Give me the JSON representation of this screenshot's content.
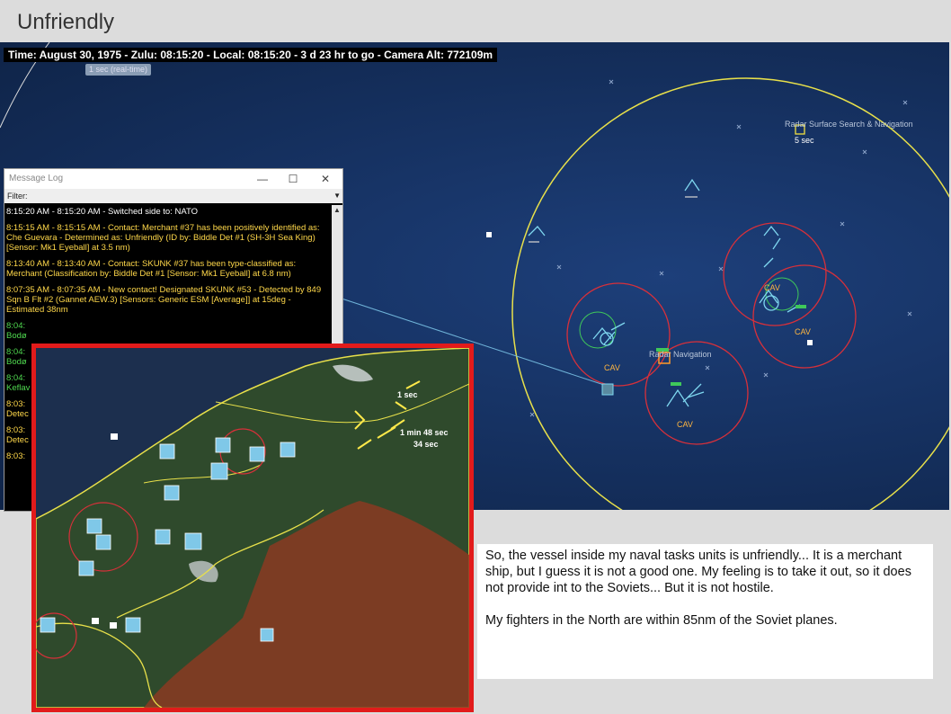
{
  "slide": {
    "title": "Unfriendly"
  },
  "game": {
    "time_bar": "Time: August 30, 1975 - Zulu: 08:15:20 - Local: 08:15:20 - 3 d 23 hr to go -  Camera Alt: 772109m",
    "speed_label": "1 sec (real-time)",
    "map_labels": {
      "radar_surface": "Radar Surface Search & Navigation",
      "radar_navigation": "Radar Navigation",
      "five_sec": "5 sec",
      "cav": "CAV",
      "inset_1sec": "1 sec",
      "inset_1min": "1 min 48 sec",
      "inset_34sec": "34 sec"
    },
    "message_log": {
      "title": "Message Log",
      "filter_label": "Filter:",
      "minimize": "—",
      "maximize": "☐",
      "close": "✕",
      "entries": [
        {
          "text": "8:15:20 AM - 8:15:20 AM - Switched side to: NATO",
          "color": "#ffffff"
        },
        {
          "text": "8:15:15 AM - 8:15:15 AM - Contact: Merchant #37 has been positively identified as: Che Guevara - Determined as: Unfriendly (ID by: Biddle Det #1 (SH-3H Sea King) [Sensor: Mk1 Eyeball] at 3.5 nm)",
          "color": "#ffd84a"
        },
        {
          "text": "8:13:40 AM - 8:13:40 AM - Contact: SKUNK #37 has been type-classified as: Merchant (Classification by: Biddle Det #1 [Sensor: Mk1 Eyeball] at 6.8 nm)",
          "color": "#ffd84a"
        },
        {
          "text": "8:07:35 AM - 8:07:35 AM - New contact! Designated SKUNK #53 - Detected by 849 Sqn B Flt #2 (Gannet AEW.3) [Sensors: Generic ESM [Average]] at 15deg - Estimated 38nm",
          "color": "#ffd84a"
        },
        {
          "text": "8:04:",
          "color": "#4fd84f",
          "sub": "Bodø"
        },
        {
          "text": "8:04:",
          "color": "#4fd84f",
          "sub": "Bodø"
        },
        {
          "text": "8:04:",
          "color": "#4fd84f",
          "sub": "Keflav"
        },
        {
          "text": "8:03:",
          "color": "#ffd84a",
          "sub": "Detec"
        },
        {
          "text": "8:03:",
          "color": "#ffd84a",
          "sub": "Detec"
        },
        {
          "text": "8:03:",
          "color": "#ffd84a",
          "sub": ""
        }
      ]
    }
  },
  "notes": {
    "paragraph1": "So, the vessel inside my naval tasks units is unfriendly...  It is a merchant ship, but I guess it is not a good one.  My feeling is to take it out, so it does not provide int to the Soviets...  But it is not hostile.",
    "paragraph2": "My fighters in the North are within 85nm of the Soviet planes."
  },
  "colors": {
    "map_ocean": "#15305f",
    "range_ring_yellow": "#e8e04a",
    "range_ring_red": "#d8303a",
    "friendly_unit": "#7fd8f0",
    "unfriendly_unit": "#ffd84a",
    "inset_border": "#e21b1b"
  }
}
